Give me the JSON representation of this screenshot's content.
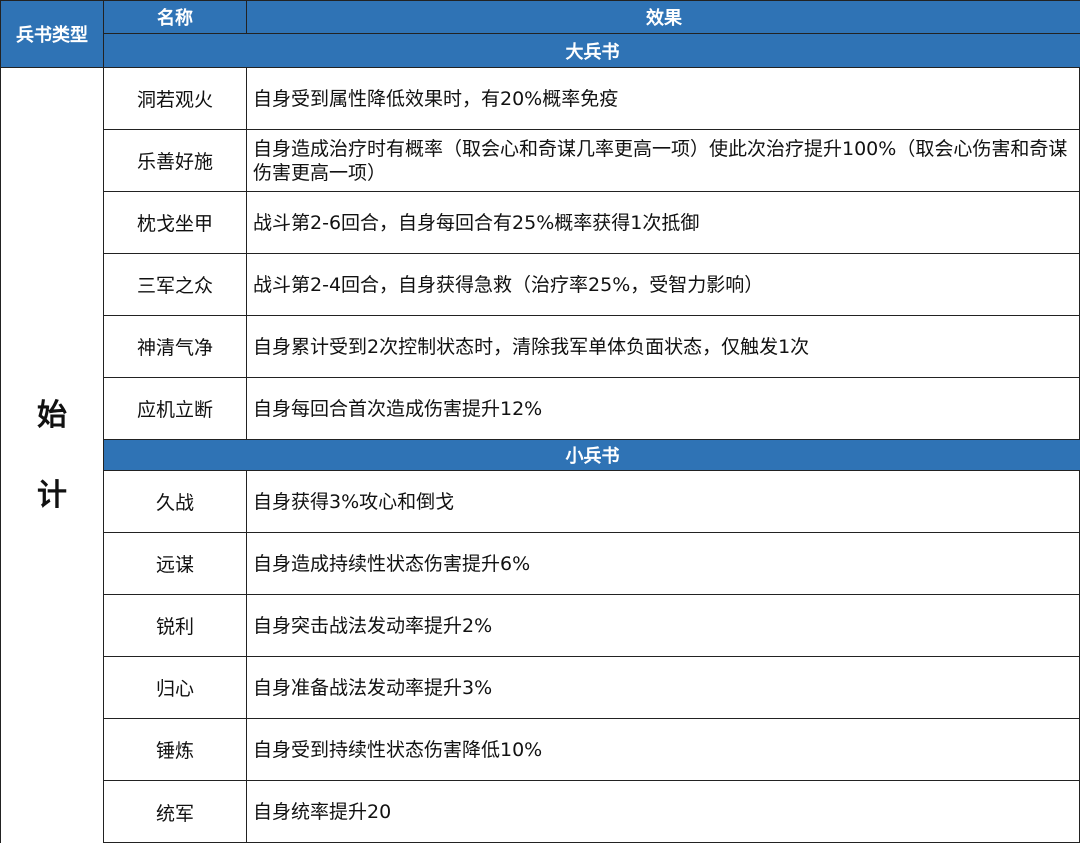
{
  "header": {
    "type_label": "兵书类型",
    "name_label": "名称",
    "effect_label": "效果"
  },
  "sections": [
    {
      "title": "大兵书",
      "rows": [
        {
          "name": "洞若观火",
          "effect": "自身受到属性降低效果时，有20%概率免疫"
        },
        {
          "name": "乐善好施",
          "effect": "自身造成治疗时有概率（取会心和奇谋几率更高一项）使此次治疗提升100%（取会心伤害和奇谋伤害更高一项）"
        },
        {
          "name": "枕戈坐甲",
          "effect": "战斗第2-6回合，自身每回合有25%概率获得1次抵御"
        },
        {
          "name": "三军之众",
          "effect": "战斗第2-4回合，自身获得急救（治疗率25%，受智力影响）"
        },
        {
          "name": "神清气净",
          "effect": "自身累计受到2次控制状态时，清除我军单体负面状态，仅触发1次"
        },
        {
          "name": "应机立断",
          "effect": "自身每回合首次造成伤害提升12%"
        }
      ]
    },
    {
      "title": "小兵书",
      "rows": [
        {
          "name": "久战",
          "effect": "自身获得3%攻心和倒戈"
        },
        {
          "name": "远谋",
          "effect": "自身造成持续性状态伤害提升6%"
        },
        {
          "name": "锐利",
          "effect": "自身突击战法发动率提升2%"
        },
        {
          "name": "归心",
          "effect": "自身准备战法发动率提升3%"
        },
        {
          "name": "锤炼",
          "effect": "自身受到持续性状态伤害降低10%"
        },
        {
          "name": "统军",
          "effect": "自身统率提升20"
        }
      ]
    }
  ],
  "type": {
    "char1": "始",
    "char2": "计"
  },
  "colors": {
    "header_bg": "#2f73b5",
    "header_text": "#ffffff",
    "border": "#222222"
  }
}
